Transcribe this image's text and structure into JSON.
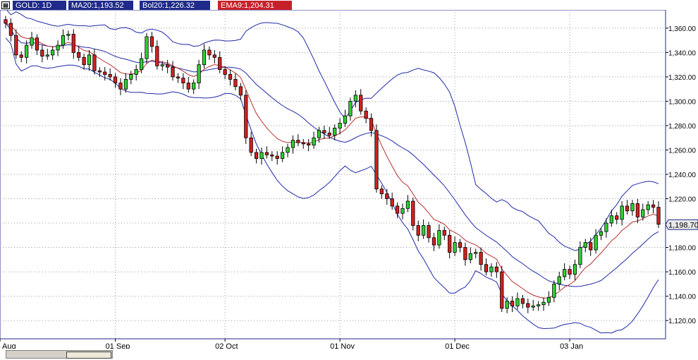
{
  "header": {
    "symbol": "GOLD: 1D",
    "ma": "MA20:1,193.52",
    "bol": "Bol20:1,226.32",
    "ema": "EMA9:1,204.31",
    "colors": {
      "symbol": "#1f2a8a",
      "ma": "#1f2a8a",
      "bol": "#1f2a8a",
      "ema": "#c8202a"
    }
  },
  "chart_data": {
    "type": "candlestick",
    "ylim": [
      1105,
      1375
    ],
    "y_ticks": [
      1120,
      1140,
      1160,
      1180,
      1200,
      1220,
      1240,
      1260,
      1280,
      1300,
      1320,
      1340,
      1360
    ],
    "y_tick_labels": [
      "1,120.00",
      "1,140.00",
      "1,160.00",
      "1,180.00",
      "1,200.00",
      "1,220.00",
      "1,240.00",
      "1,260.00",
      "1,280.00",
      "1,300.00",
      "1,320.00",
      "1,340.00",
      "1,360.00"
    ],
    "x_labels": [
      "Aug",
      "01 Sep",
      "02 Oct",
      "01 Nov",
      "01 Dec",
      "03 Jan"
    ],
    "last_price": 1198.7,
    "last_price_label": "1,198.70",
    "closes": [
      1364,
      1354,
      1338,
      1336,
      1346,
      1352,
      1342,
      1337,
      1338,
      1342,
      1346,
      1354,
      1355,
      1340,
      1336,
      1330,
      1338,
      1325,
      1324,
      1322,
      1320,
      1315,
      1310,
      1318,
      1322,
      1326,
      1335,
      1353,
      1345,
      1329,
      1330,
      1328,
      1320,
      1319,
      1315,
      1310,
      1315,
      1330,
      1342,
      1338,
      1336,
      1326,
      1322,
      1318,
      1312,
      1305,
      1270,
      1258,
      1253,
      1258,
      1256,
      1255,
      1253,
      1258,
      1262,
      1268,
      1266,
      1265,
      1264,
      1270,
      1276,
      1274,
      1272,
      1278,
      1282,
      1288,
      1300,
      1305,
      1292,
      1286,
      1276,
      1228,
      1224,
      1220,
      1214,
      1208,
      1212,
      1218,
      1198,
      1190,
      1198,
      1188,
      1182,
      1194,
      1190,
      1176,
      1184,
      1180,
      1170,
      1175,
      1176,
      1166,
      1160,
      1164,
      1160,
      1130,
      1136,
      1132,
      1138,
      1134,
      1131,
      1132,
      1133,
      1135,
      1139,
      1150,
      1156,
      1162,
      1158,
      1166,
      1180,
      1184,
      1178,
      1190,
      1193,
      1200,
      1206,
      1203,
      1214,
      1210,
      1216,
      1205,
      1211,
      1215,
      1213,
      1199
    ]
  }
}
